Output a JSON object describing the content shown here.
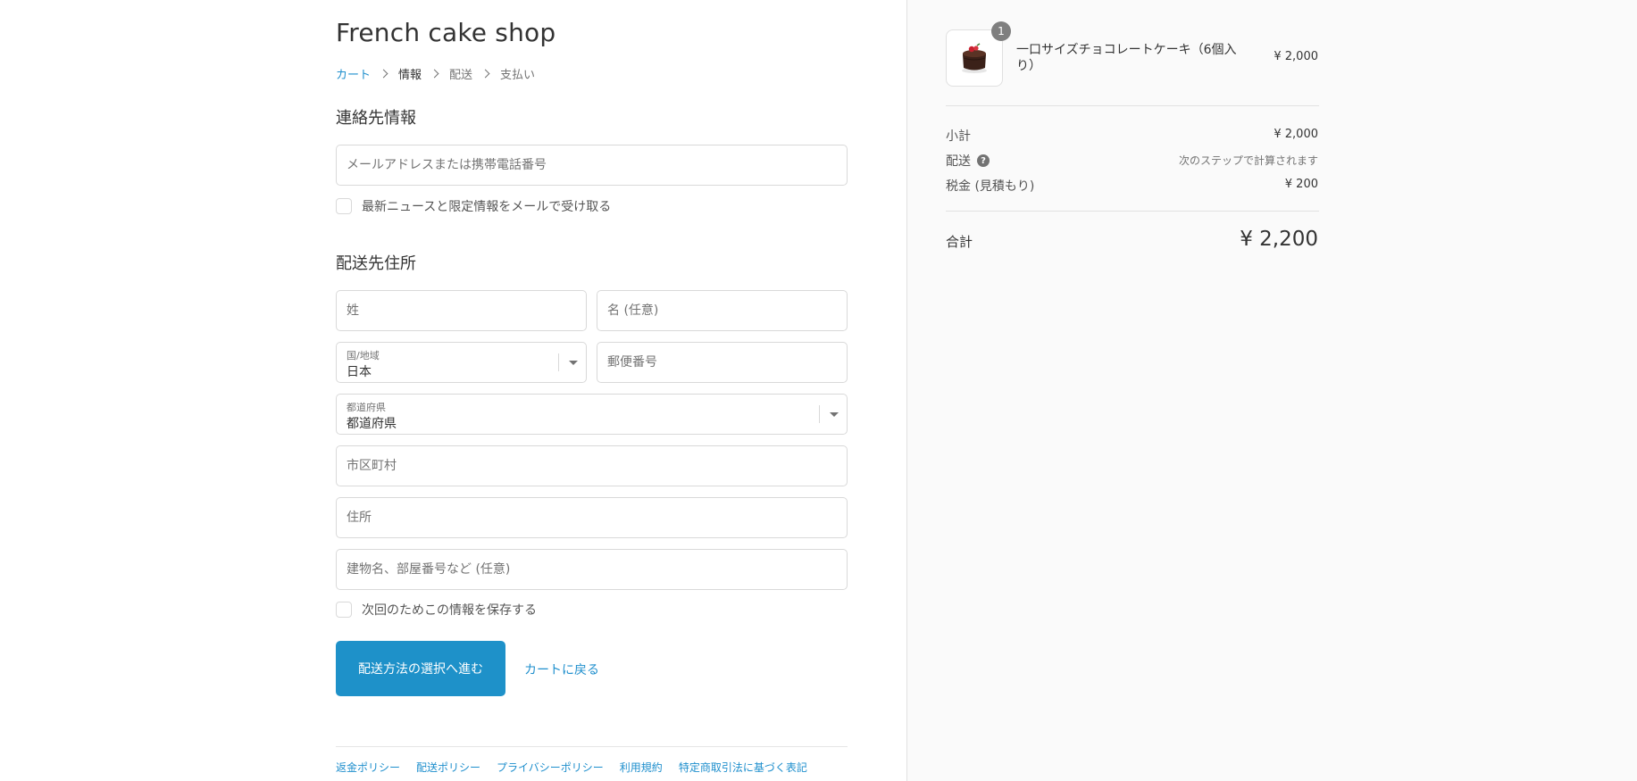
{
  "header": {
    "shop_title": "French cake shop",
    "breadcrumb": [
      {
        "label": "カート"
      },
      {
        "label": "情報"
      },
      {
        "label": "配送"
      },
      {
        "label": "支払い"
      }
    ]
  },
  "contact": {
    "title": "連絡先情報",
    "email_placeholder": "メールアドレスまたは携帯電話番号",
    "newsletter_label": "最新ニュースと限定情報をメールで受け取る"
  },
  "shipping": {
    "title": "配送先住所",
    "last_name_placeholder": "姓",
    "first_name_placeholder": "名 (任意)",
    "country_label": "国/地域",
    "country_value": "日本",
    "postal_placeholder": "郵便番号",
    "prefecture_label": "都道府県",
    "prefecture_value": "都道府県",
    "city_placeholder": "市区町村",
    "address_placeholder": "住所",
    "building_placeholder": "建物名、部屋番号など (任意)",
    "save_info_label": "次回のためこの情報を保存する"
  },
  "actions": {
    "continue_label": "配送方法の選択へ進む",
    "back_label": "カートに戻る"
  },
  "footer": {
    "links": [
      "返金ポリシー",
      "配送ポリシー",
      "プライバシーポリシー",
      "利用規約",
      "特定商取引法に基づく表記"
    ]
  },
  "order": {
    "item": {
      "name": "一口サイズチョコレートケーキ（6個入り）",
      "price": "¥ 2,000",
      "quantity": "1"
    },
    "subtotal_label": "小計",
    "subtotal_value": "¥ 2,000",
    "shipping_label": "配送",
    "shipping_value": "次のステップで計算されます",
    "tax_label": "税金 (見積もり)",
    "tax_value": "¥ 200",
    "total_label": "合計",
    "total_value": "¥ 2,200"
  },
  "colors": {
    "accent": "#1e91c9",
    "link": "#1f8fcd",
    "sidebar_bg": "#fafafa"
  }
}
